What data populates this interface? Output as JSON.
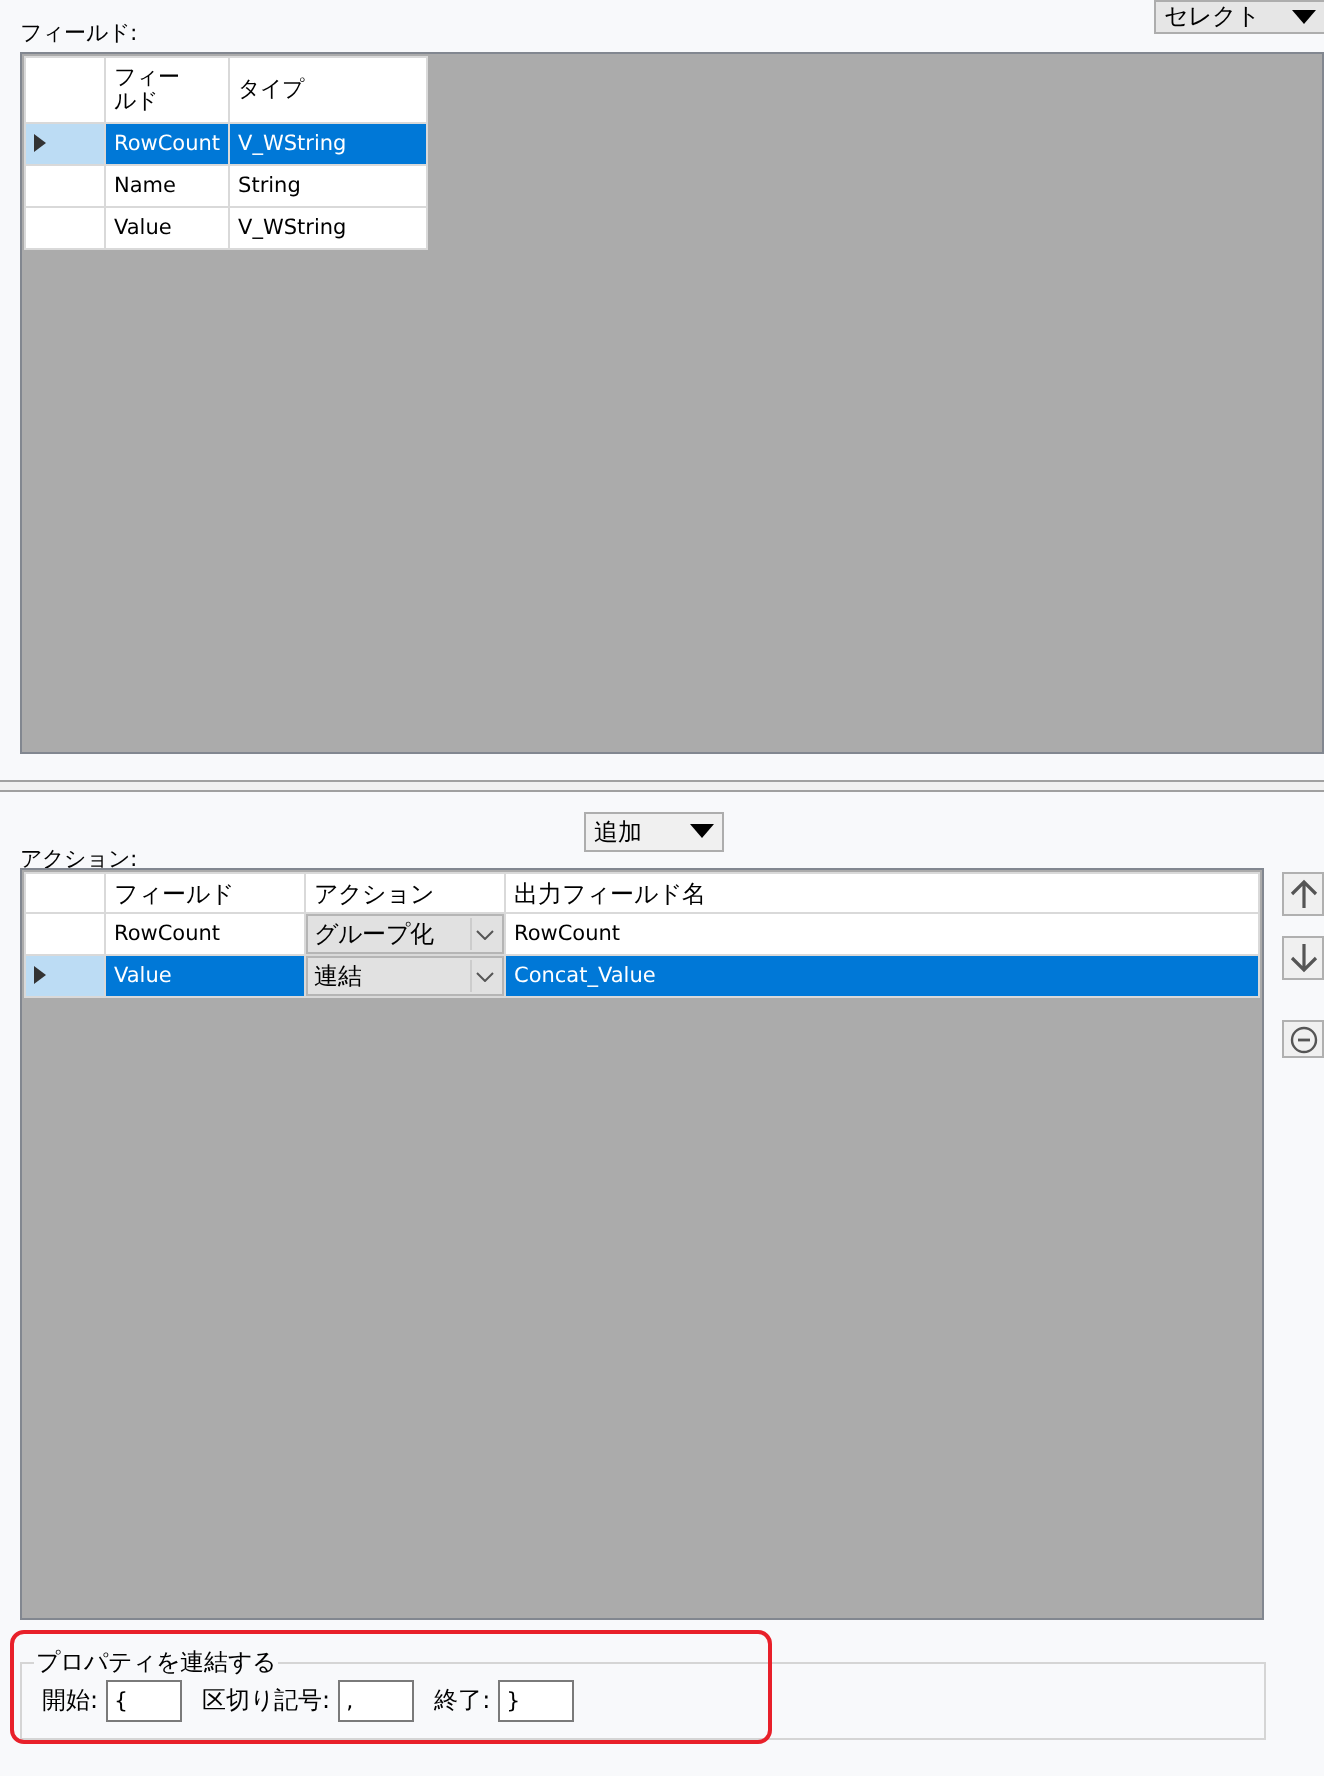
{
  "fields_section": {
    "label": "フィールド:",
    "select_button": "セレクト",
    "columns": [
      "フィールド",
      "タイプ"
    ],
    "rows": [
      {
        "field": "RowCount",
        "type": "V_WString",
        "selected": true
      },
      {
        "field": "Name",
        "type": "String",
        "selected": false
      },
      {
        "field": "Value",
        "type": "V_WString",
        "selected": false
      }
    ]
  },
  "actions_section": {
    "label": "アクション:",
    "add_button": "追加",
    "columns": [
      "フィールド",
      "アクション",
      "出力フィールド名"
    ],
    "rows": [
      {
        "field": "RowCount",
        "action": "グループ化",
        "output": "RowCount",
        "selected": false
      },
      {
        "field": "Value",
        "action": "連結",
        "output": "Concat_Value",
        "selected": true
      }
    ]
  },
  "concat_properties": {
    "title": "プロパティを連結する",
    "highlighted": true,
    "fields": [
      {
        "label": "開始:",
        "value": "{"
      },
      {
        "label": "区切り記号:",
        "value": ","
      },
      {
        "label": "終了:",
        "value": "}"
      }
    ]
  }
}
